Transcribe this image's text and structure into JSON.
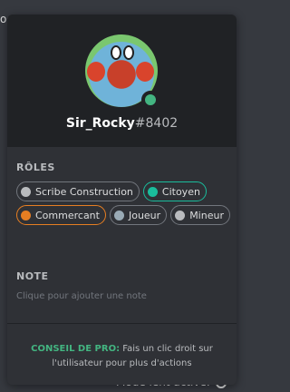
{
  "background": {
    "top_left_text": "oc",
    "bottom_right_text": "Mode lent activé."
  },
  "profile": {
    "username": "Sir_Rocky",
    "discriminator": "#8402",
    "status_color": "#43b581"
  },
  "roles_section": {
    "title": "RÔLES",
    "roles": [
      {
        "name": "Scribe Construction",
        "color": "#b9bbbe",
        "border": "#72767d"
      },
      {
        "name": "Citoyen",
        "color": "#1abc9c",
        "border": "#1abc9c"
      },
      {
        "name": "Commercant",
        "color": "#e67e22",
        "border": "#e67e22"
      },
      {
        "name": "Joueur",
        "color": "#99aab5",
        "border": "#72767d"
      },
      {
        "name": "Mineur",
        "color": "#b9bbbe",
        "border": "#72767d"
      }
    ]
  },
  "note_section": {
    "title": "NOTE",
    "placeholder": "Clique pour ajouter une note"
  },
  "tip": {
    "label": "CONSEIL DE PRO:",
    "text": " Fais un clic droit sur l'utilisateur pour plus d'actions"
  }
}
